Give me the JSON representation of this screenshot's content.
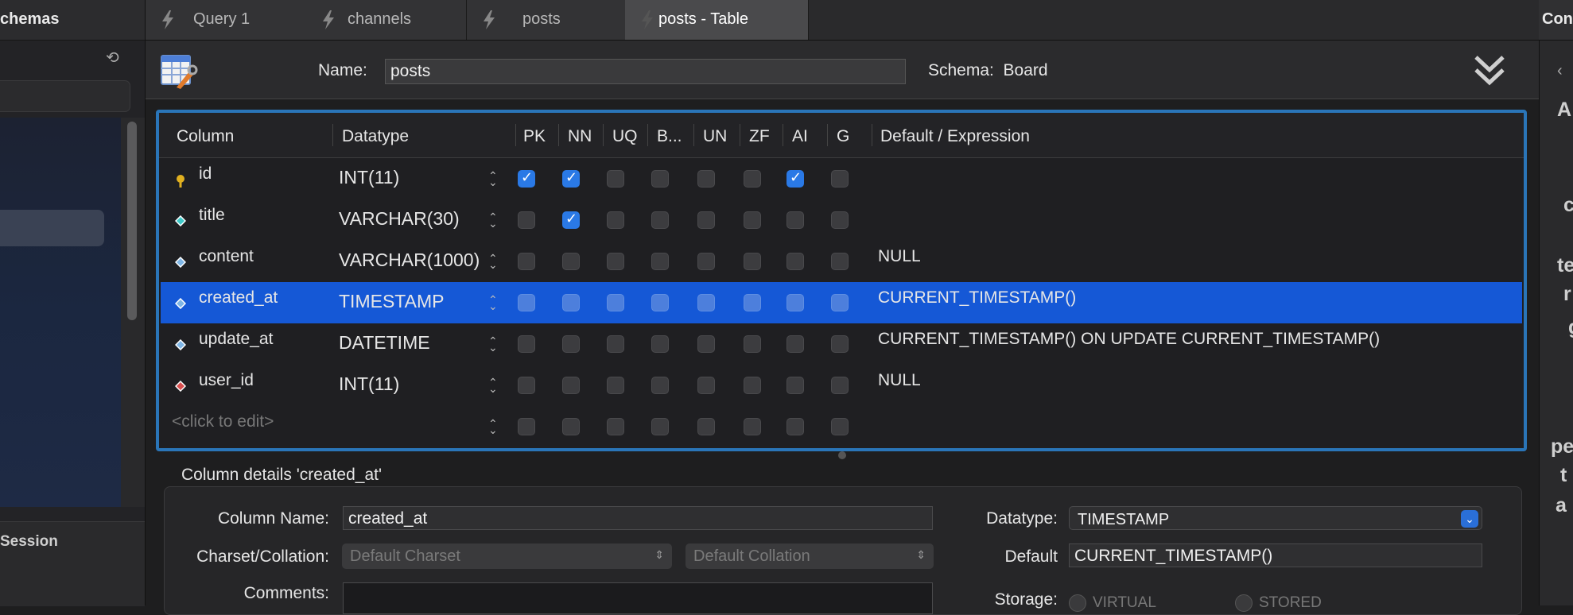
{
  "sidebar": {
    "title": "chemas",
    "session_label": "Session"
  },
  "tabs": [
    {
      "label": "Query 1",
      "active": false
    },
    {
      "label": "channels",
      "active": false
    },
    {
      "label": "posts",
      "active": false
    },
    {
      "label": "posts - Table",
      "active": true
    }
  ],
  "table_editor": {
    "name_label": "Name:",
    "name_value": "posts",
    "schema_label": "Schema:",
    "schema_value": "Board"
  },
  "grid": {
    "headers": [
      "Column",
      "Datatype",
      "PK",
      "NN",
      "UQ",
      "B...",
      "UN",
      "ZF",
      "AI",
      "G",
      "Default / Expression"
    ],
    "rows": [
      {
        "name": "id",
        "type": "INT(11)",
        "icon": "primary-key-icon",
        "flags": [
          true,
          true,
          false,
          false,
          false,
          false,
          true,
          false
        ],
        "default": ""
      },
      {
        "name": "title",
        "type": "VARCHAR(30)",
        "icon": "not-null-column-icon",
        "flags": [
          false,
          true,
          false,
          false,
          false,
          false,
          false,
          false
        ],
        "default": ""
      },
      {
        "name": "content",
        "type": "VARCHAR(1000)",
        "icon": "column-icon",
        "flags": [
          false,
          false,
          false,
          false,
          false,
          false,
          false,
          false
        ],
        "default": "NULL"
      },
      {
        "name": "created_at",
        "type": "TIMESTAMP",
        "icon": "column-icon",
        "flags": [
          false,
          false,
          false,
          false,
          false,
          false,
          false,
          false
        ],
        "default": "CURRENT_TIMESTAMP()",
        "selected": true
      },
      {
        "name": "update_at",
        "type": "DATETIME",
        "icon": "column-icon",
        "flags": [
          false,
          false,
          false,
          false,
          false,
          false,
          false,
          false
        ],
        "default": "CURRENT_TIMESTAMP() ON UPDATE CURRENT_TIMESTAMP()"
      },
      {
        "name": "user_id",
        "type": "INT(11)",
        "icon": "foreign-key-column-icon",
        "flags": [
          false,
          false,
          false,
          false,
          false,
          false,
          false,
          false
        ],
        "default": "NULL"
      },
      {
        "name": "<click to edit>",
        "type": "",
        "icon": "",
        "flags": [
          false,
          false,
          false,
          false,
          false,
          false,
          false,
          false
        ],
        "default": "",
        "placeholder": true
      }
    ]
  },
  "details": {
    "title": "Column details 'created_at'",
    "column_name_label": "Column Name:",
    "column_name_value": "created_at",
    "charset_label": "Charset/Collation:",
    "charset_value": "Default Charset",
    "collation_value": "Default Collation",
    "comments_label": "Comments:",
    "datatype_label": "Datatype:",
    "datatype_value": "TIMESTAMP",
    "default_label": "Default",
    "default_value": "CURRENT_TIMESTAMP()",
    "storage_label": "Storage:",
    "storage_virtual": "VIRTUAL",
    "storage_stored": "STORED"
  },
  "right_panel": {
    "title": "Cont",
    "chars": [
      "A",
      "c",
      "te",
      "r",
      "g",
      "pe",
      "t",
      "a"
    ]
  },
  "colors": {
    "accent": "#2a75b8",
    "selection": "#1558d6",
    "checkbox_on": "#2a79e6"
  }
}
